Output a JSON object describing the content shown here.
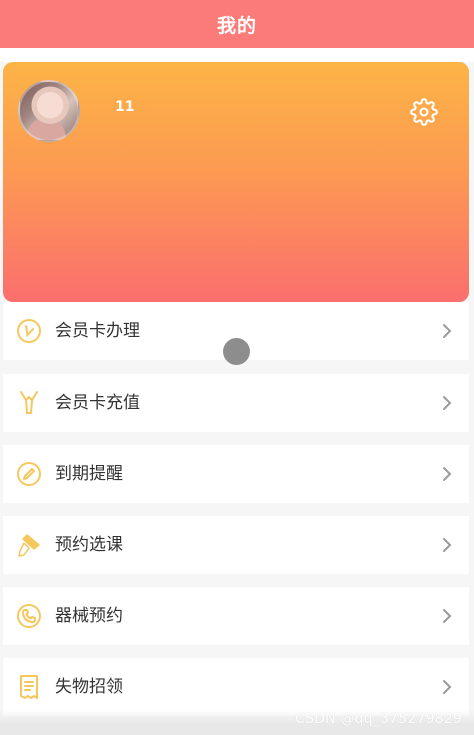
{
  "header": {
    "title": "我的"
  },
  "profile": {
    "username": "11",
    "avatar_icon": "avatar-photo",
    "settings_icon": "gear-icon"
  },
  "colors": {
    "header_bg": "#fb7b78",
    "card_gradient_top": "#fdb446",
    "card_gradient_bottom": "#fb6f6e",
    "icon_color": "#f5c75c",
    "chevron_color": "#9a9a9a"
  },
  "menu": {
    "items": [
      {
        "label": "会员卡办理",
        "icon": "clock-check-icon"
      },
      {
        "label": "会员卡充值",
        "icon": "tie-recharge-icon"
      },
      {
        "label": "到期提醒",
        "icon": "pencil-circle-icon"
      },
      {
        "label": "预约选课",
        "icon": "trowel-icon"
      },
      {
        "label": "器械预约",
        "icon": "phone-circle-icon"
      },
      {
        "label": "失物招领",
        "icon": "receipt-icon"
      }
    ]
  },
  "watermark": "CSDN @qq_375279829"
}
